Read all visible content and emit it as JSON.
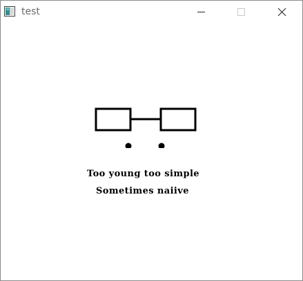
{
  "window": {
    "title": "test",
    "icons": {
      "app": "app-window-icon",
      "minimize": "minimize-icon",
      "maximize": "maximize-icon",
      "close": "close-icon"
    }
  },
  "content": {
    "drawing": "glasses-face-icon",
    "line1": "Too young too simple",
    "line2": "Sometimes naiive"
  },
  "colors": {
    "title_text": "#6b6b6b",
    "drawing": "#000000",
    "background": "#ffffff"
  }
}
